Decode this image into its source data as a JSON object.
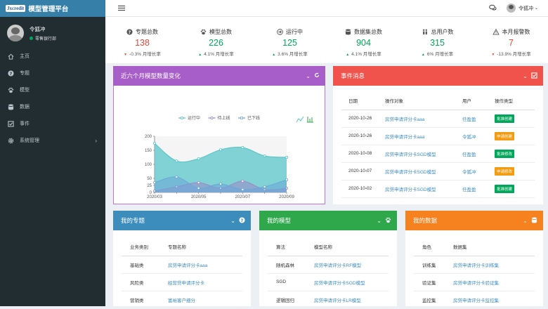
{
  "brand": {
    "logo_text": "Jxcredit",
    "title": "模型管理平台"
  },
  "user": {
    "name": "令狐冲",
    "dept": "零售银行部"
  },
  "nav": [
    {
      "label": "主页",
      "icon": "home-icon"
    },
    {
      "label": "专题",
      "icon": "question-circle-icon"
    },
    {
      "label": "模型",
      "icon": "paw-icon"
    },
    {
      "label": "数据",
      "icon": "database-icon"
    },
    {
      "label": "事件",
      "icon": "check-square-icon"
    },
    {
      "label": "系统管理",
      "icon": "gear-icon"
    }
  ],
  "topbar": {
    "user_name": "令狐冲"
  },
  "stats": [
    {
      "label": "专题总数",
      "value": "138",
      "change": "-0.3% 月增长率",
      "direction": "down",
      "color": "#dd4b39",
      "icon": "question-circle-icon"
    },
    {
      "label": "模型总数",
      "value": "226",
      "change": "4.1% 月增长率",
      "direction": "up",
      "color": "#00a65a",
      "icon": "paw-icon"
    },
    {
      "label": "运行中",
      "value": "125",
      "change": "3.6% 月增长率",
      "direction": "up",
      "color": "#00a65a",
      "icon": "arrow-circle-right-icon"
    },
    {
      "label": "数据集总数",
      "value": "904",
      "change": "4.1% 月增长率",
      "direction": "up",
      "color": "#00a65a",
      "icon": "database-icon"
    },
    {
      "label": "总用户数",
      "value": "315",
      "change": "6% 月增长率",
      "direction": "up",
      "color": "#00a65a",
      "icon": "users-icon"
    },
    {
      "label": "本月报警数",
      "value": "7",
      "change": "-13.9% 月增长率",
      "direction": "down",
      "color": "#dd4b39",
      "icon": "warning-icon"
    }
  ],
  "chart_panel": {
    "title": "近六个月模型数量变化",
    "color": "#8e44ad"
  },
  "chart_data": {
    "type": "area",
    "x": [
      "2020/03",
      "2020/04",
      "2020/05",
      "2020/06",
      "2020/07",
      "2020/08",
      "2020/09"
    ],
    "x_tick_labels": [
      "2020/03",
      "2020/05",
      "2020/07",
      "2020/09"
    ],
    "ylim": [
      0,
      200
    ],
    "y_ticks": [
      0,
      25,
      50,
      100,
      150,
      200
    ],
    "legend": "top-center",
    "series": [
      {
        "name": "运行中",
        "color": "#4fc3c7",
        "values": [
          175,
          112,
          120,
          152,
          160,
          130,
          125
        ]
      },
      {
        "name": "待上线",
        "color": "#9b87c9",
        "values": [
          5,
          20,
          35,
          15,
          40,
          10,
          15
        ]
      },
      {
        "name": "已下线",
        "color": "#6aa6d8",
        "values": [
          35,
          55,
          15,
          30,
          10,
          20,
          45
        ]
      }
    ]
  },
  "events_panel": {
    "title": "事件消息",
    "color": "#f0524c",
    "headers": [
      "日期",
      "操作对象",
      "用户",
      "操作类型"
    ],
    "rows": [
      {
        "date": "2020-10-26",
        "object": "房贷申请评分卡aaa",
        "user": "任盈盈",
        "type": "批准创建",
        "type_color": "#00a65a"
      },
      {
        "date": "2020-10-26",
        "object": "房贷申请评分卡aaa",
        "user": "令狐冲",
        "type": "申请创建",
        "type_color": "#f39c12"
      },
      {
        "date": "2020-10-08",
        "object": "房贷申请评分卡SGD模型",
        "user": "任盈盈",
        "type": "批准修改",
        "type_color": "#00a65a"
      },
      {
        "date": "2020-10-07",
        "object": "房贷申请评分卡SGD模型",
        "user": "令狐冲",
        "type": "申请修改",
        "type_color": "#f39c12"
      },
      {
        "date": "2020-10-02",
        "object": "房贷申请评分卡SGD模型",
        "user": "任盈盈",
        "type": "批准创建",
        "type_color": "#00a65a"
      }
    ]
  },
  "topics_panel": {
    "title": "我的专题",
    "color": "#3c8dbc",
    "headers": [
      "业务类别",
      "专题名称"
    ],
    "rows": [
      [
        "基础类",
        "房贷申请评分卡aaa"
      ],
      [
        "风险类",
        "经营贷申请评分卡"
      ],
      [
        "营销类",
        "富裕客户细分"
      ]
    ]
  },
  "models_panel": {
    "title": "我的模型",
    "color": "#2ea84a",
    "headers": [
      "算法",
      "模型名称"
    ],
    "rows": [
      [
        "随机森林",
        "房贷申请评分卡RF模型"
      ],
      [
        "SGD",
        "房贷申请评分卡SGD模型"
      ],
      [
        "逻辑回归",
        "房贷申请评分卡LR模型"
      ]
    ]
  },
  "data_panel": {
    "title": "我的数据",
    "color": "#f5821f",
    "headers": [
      "角色",
      "数据集"
    ],
    "rows": [
      [
        "训练集",
        "房贷申请评分卡训练集"
      ],
      [
        "验证集",
        "房贷申请评分卡验证集"
      ],
      [
        "监控集",
        "房贷申请评分卡监控集"
      ]
    ]
  }
}
